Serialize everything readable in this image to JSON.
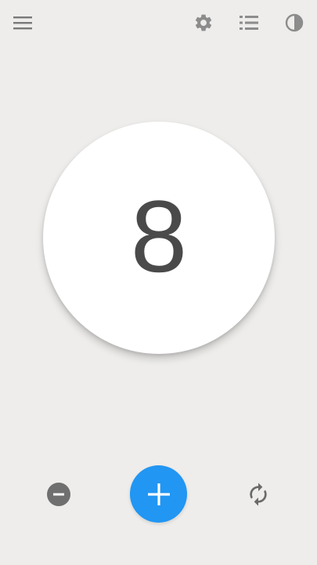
{
  "counter": {
    "value": "8"
  },
  "toolbar": {
    "icons": [
      "menu-icon",
      "settings-icon",
      "list-icon",
      "theme-contrast-icon"
    ]
  },
  "controls": {
    "icons": [
      "minus-icon",
      "plus-icon",
      "reset-icon"
    ]
  },
  "colors": {
    "background": "#eeedeb",
    "toolbar_icon": "#8a8a8a",
    "counter_text": "#4a4a4a",
    "accent": "#2196f3",
    "minus_button": "#6f6f6f",
    "reset_icon": "#6a6a6a"
  }
}
